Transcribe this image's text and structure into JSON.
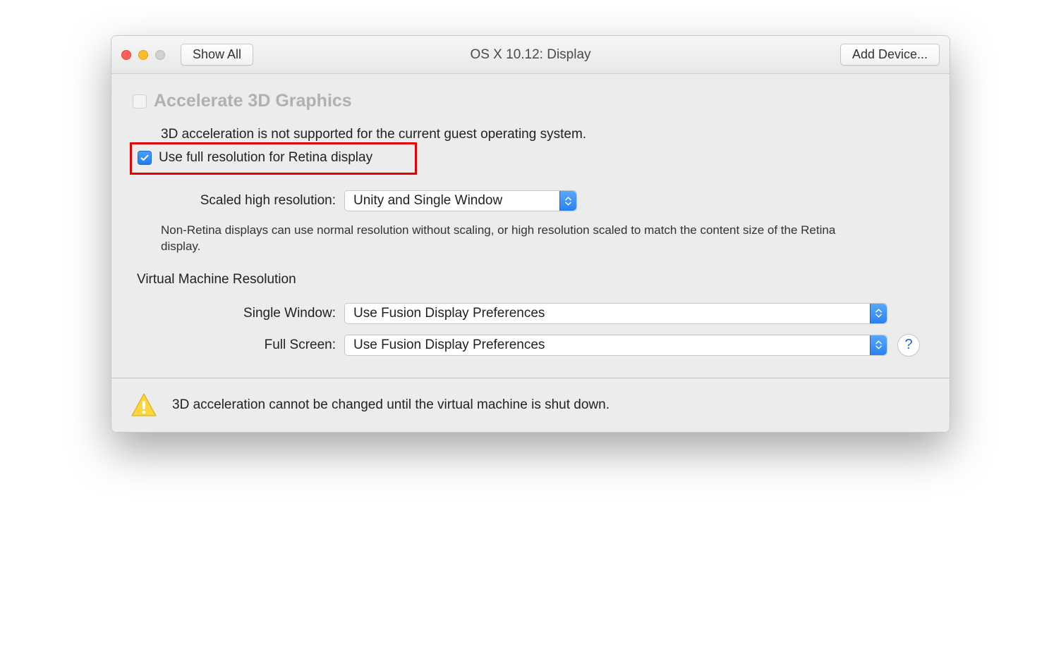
{
  "titlebar": {
    "title": "OS X 10.12: Display",
    "show_all": "Show All",
    "add_device": "Add Device..."
  },
  "accelerate": {
    "label": "Accelerate 3D Graphics",
    "message": "3D acceleration is not supported for the current guest operating system."
  },
  "retina": {
    "label": "Use full resolution for Retina display"
  },
  "scaled": {
    "label": "Scaled high resolution:",
    "value": "Unity and Single Window",
    "hint": "Non-Retina displays can use normal resolution without scaling, or high resolution scaled to match the content size of the Retina display."
  },
  "vm": {
    "heading": "Virtual Machine Resolution",
    "single_window_label": "Single Window:",
    "single_window_value": "Use Fusion Display Preferences",
    "full_screen_label": "Full Screen:",
    "full_screen_value": "Use Fusion Display Preferences"
  },
  "help": {
    "label": "?"
  },
  "footer": {
    "message": "3D acceleration cannot be changed until the virtual machine is shut down."
  }
}
